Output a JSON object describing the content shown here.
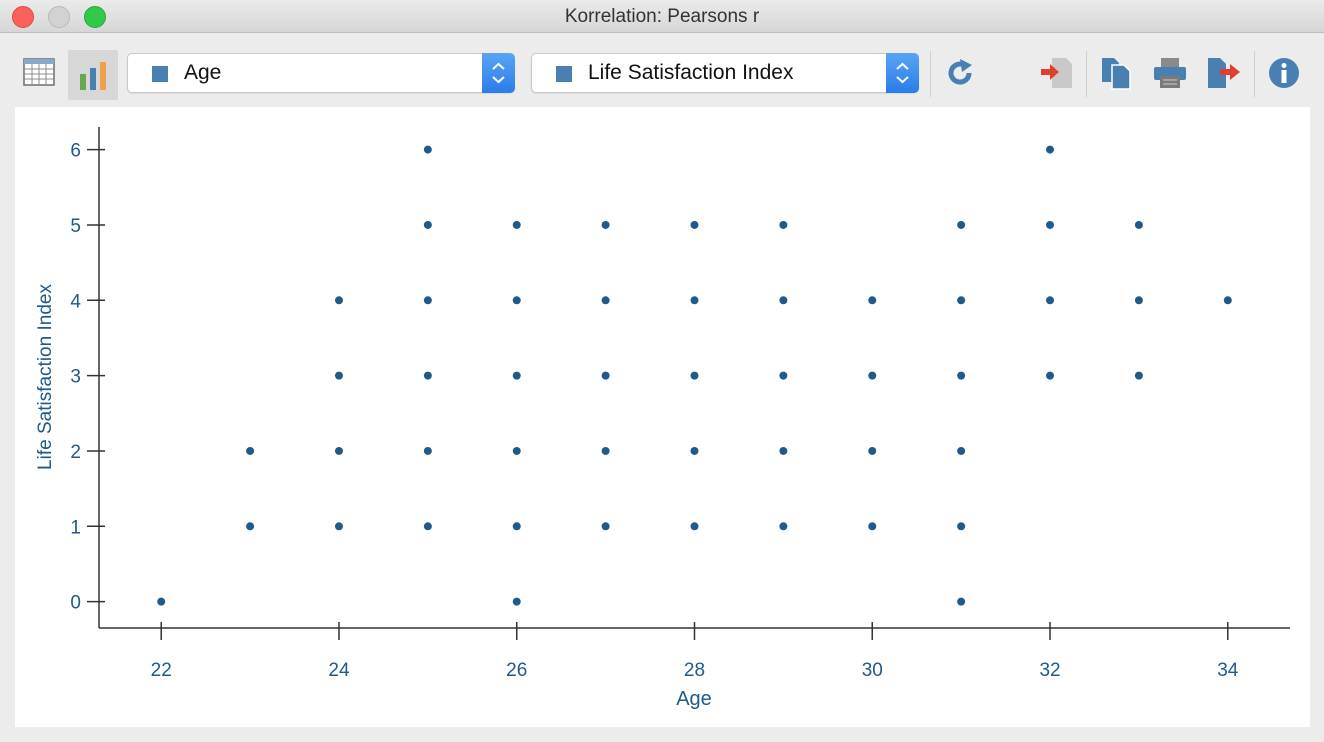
{
  "window": {
    "title": "Korrelation: Pearsons r"
  },
  "toolbar": {
    "x_variable": "Age",
    "y_variable": "Life Satisfaction Index",
    "icons": [
      "table-view-icon",
      "chart-view-icon",
      "refresh-icon",
      "import-icon",
      "copy-icon",
      "print-icon",
      "export-icon",
      "info-icon"
    ]
  },
  "colors": {
    "accent": "#1f5a8a",
    "dropdown_square": "#4a7fb1"
  },
  "chart_data": {
    "type": "scatter",
    "xlabel": "Age",
    "ylabel": "Life Satisfaction Index",
    "xlim": [
      21.3,
      34.7
    ],
    "ylim": [
      -0.35,
      6.3
    ],
    "xticks": [
      22,
      24,
      26,
      28,
      30,
      32,
      34
    ],
    "yticks": [
      0,
      1,
      2,
      3,
      4,
      5,
      6
    ],
    "grid": false,
    "points": [
      [
        22,
        0
      ],
      [
        23,
        1
      ],
      [
        23,
        2
      ],
      [
        24,
        1
      ],
      [
        24,
        2
      ],
      [
        24,
        3
      ],
      [
        24,
        4
      ],
      [
        25,
        1
      ],
      [
        25,
        2
      ],
      [
        25,
        3
      ],
      [
        25,
        4
      ],
      [
        25,
        5
      ],
      [
        25,
        6
      ],
      [
        26,
        0
      ],
      [
        26,
        1
      ],
      [
        26,
        2
      ],
      [
        26,
        3
      ],
      [
        26,
        4
      ],
      [
        26,
        5
      ],
      [
        27,
        1
      ],
      [
        27,
        2
      ],
      [
        27,
        3
      ],
      [
        27,
        4
      ],
      [
        27,
        5
      ],
      [
        28,
        1
      ],
      [
        28,
        2
      ],
      [
        28,
        3
      ],
      [
        28,
        4
      ],
      [
        28,
        5
      ],
      [
        29,
        1
      ],
      [
        29,
        2
      ],
      [
        29,
        3
      ],
      [
        29,
        4
      ],
      [
        29,
        5
      ],
      [
        30,
        1
      ],
      [
        30,
        2
      ],
      [
        30,
        3
      ],
      [
        30,
        4
      ],
      [
        31,
        0
      ],
      [
        31,
        1
      ],
      [
        31,
        2
      ],
      [
        31,
        3
      ],
      [
        31,
        4
      ],
      [
        31,
        5
      ],
      [
        32,
        3
      ],
      [
        32,
        4
      ],
      [
        32,
        5
      ],
      [
        32,
        6
      ],
      [
        33,
        3
      ],
      [
        33,
        4
      ],
      [
        33,
        5
      ],
      [
        34,
        4
      ]
    ]
  }
}
